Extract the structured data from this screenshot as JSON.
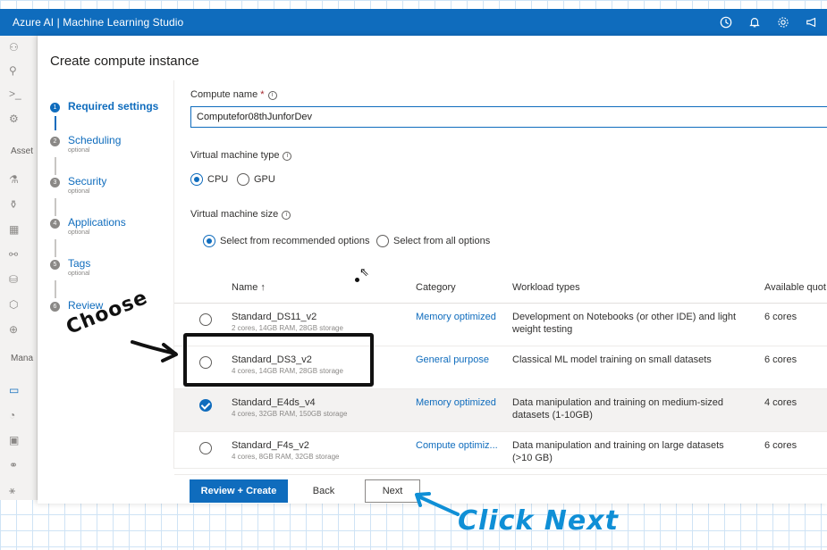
{
  "app": {
    "title": "Azure AI | Machine Learning Studio"
  },
  "topbar_icons": [
    "clock-icon",
    "bell-icon",
    "gear-icon",
    "megaphone-icon"
  ],
  "rail": {
    "assets_label": "Asset",
    "manage_label": "Mana"
  },
  "panel": {
    "title": "Create compute instance",
    "steps": [
      {
        "label": "Required settings",
        "sub": "",
        "num": "1",
        "active": true
      },
      {
        "label": "Scheduling",
        "sub": "optional",
        "num": "2"
      },
      {
        "label": "Security",
        "sub": "optional",
        "num": "3"
      },
      {
        "label": "Applications",
        "sub": "optional",
        "num": "4"
      },
      {
        "label": "Tags",
        "sub": "optional",
        "num": "5"
      },
      {
        "label": "Review",
        "sub": "",
        "num": "6"
      }
    ]
  },
  "form": {
    "compute_name_label": "Compute name",
    "required_mark": "*",
    "compute_name_value": "Computefor08thJunforDev",
    "vm_type_label": "Virtual machine type",
    "vm_type_options": [
      "CPU",
      "GPU"
    ],
    "vm_type_selected": "CPU",
    "vm_size_label": "Virtual machine size",
    "vm_size_options": [
      "Select from recommended options",
      "Select from all options"
    ],
    "vm_size_selected": "Select from recommended options"
  },
  "table": {
    "headers": {
      "name": "Name ↑",
      "category": "Category",
      "workload": "Workload types",
      "quota": "Available quot"
    },
    "rows": [
      {
        "name": "Standard_DS11_v2",
        "spec": "2 cores, 14GB RAM, 28GB storage",
        "category": "Memory optimized",
        "workload": "Development on Notebooks (or other IDE) and light weight testing",
        "quota": "6 cores",
        "selected": false
      },
      {
        "name": "Standard_DS3_v2",
        "spec": "4 cores, 14GB RAM, 28GB storage",
        "category": "General purpose",
        "workload": "Classical ML model training on small datasets",
        "quota": "6 cores",
        "selected": false
      },
      {
        "name": "Standard_E4ds_v4",
        "spec": "4 cores, 32GB RAM, 150GB storage",
        "category": "Memory optimized",
        "workload": "Data manipulation and training on medium-sized datasets (1-10GB)",
        "quota": "4 cores",
        "selected": true
      },
      {
        "name": "Standard_F4s_v2",
        "spec": "4 cores, 8GB RAM, 32GB storage",
        "category": "Compute optimiz...",
        "workload": "Data manipulation and training on large datasets (>10 GB)",
        "quota": "6 cores",
        "selected": false
      }
    ]
  },
  "footer": {
    "review_create": "Review + Create",
    "back": "Back",
    "next": "Next"
  },
  "annotations": {
    "choose": "Choose",
    "click_next": "Click Next"
  },
  "colors": {
    "accent": "#0f6cbd",
    "annotation_blue": "#0f8fd6",
    "grid": "#cfe3f5"
  }
}
